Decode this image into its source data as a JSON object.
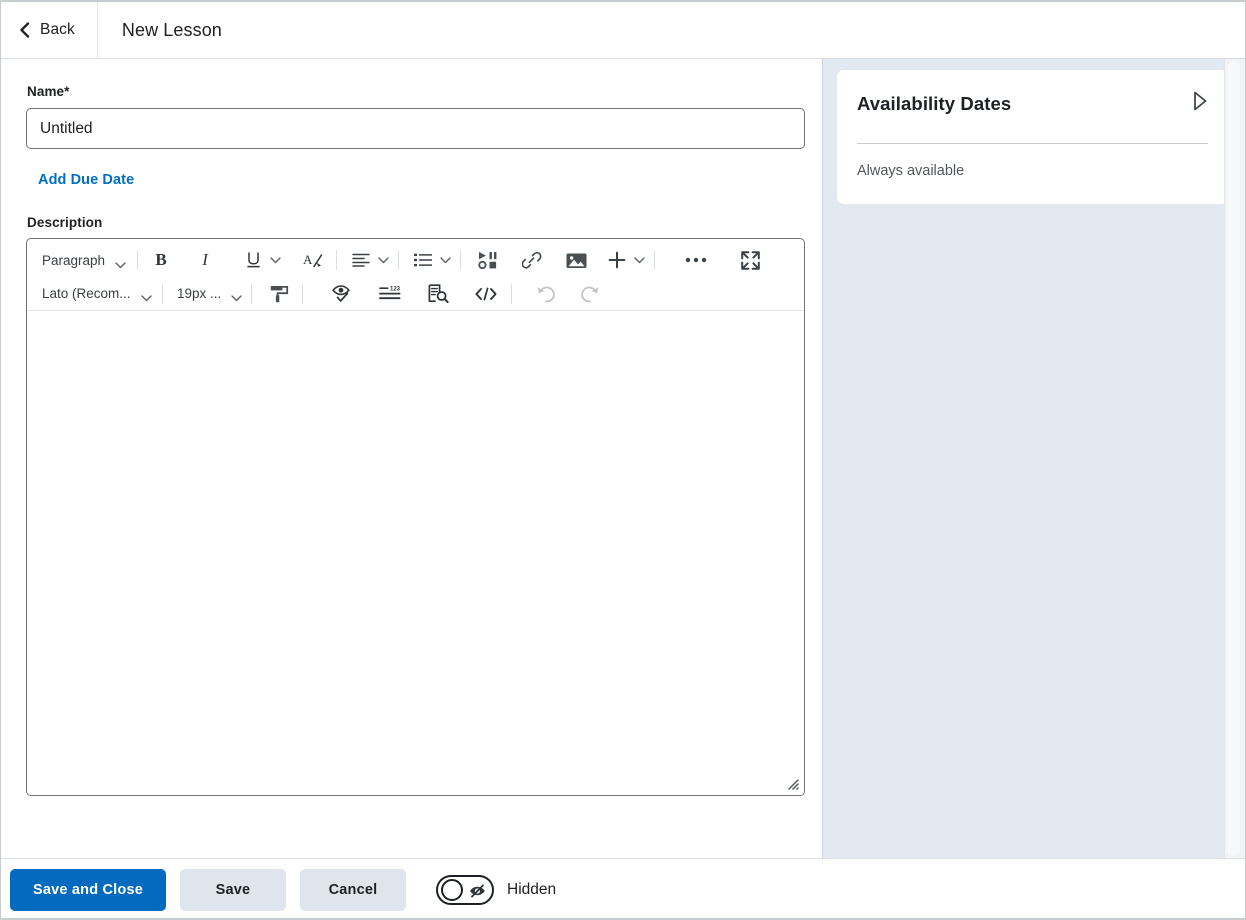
{
  "header": {
    "back_label": "Back",
    "title": "New Lesson",
    "back_icon": "chevron-left-icon"
  },
  "form": {
    "name_label": "Name",
    "name_required_mark": "*",
    "name_value": "Untitled",
    "name_placeholder": "Untitled",
    "add_due_date_label": "Add Due Date",
    "description_label": "Description"
  },
  "editor": {
    "toolbar_row1": [
      {
        "kind": "select",
        "name": "paragraph-format-select",
        "label": "Paragraph",
        "icon": "chevron-down-icon"
      },
      {
        "kind": "separator",
        "name": "toolbar-separator"
      },
      {
        "kind": "button",
        "name": "bold-button",
        "icon": "bold-icon",
        "label": "B"
      },
      {
        "kind": "button",
        "name": "italic-button",
        "icon": "italic-icon",
        "label": "I"
      },
      {
        "kind": "button",
        "name": "underline-button",
        "icon": "underline-icon",
        "label": "U"
      },
      {
        "kind": "caret",
        "name": "underline-options-caret",
        "icon": "chevron-down-icon"
      },
      {
        "kind": "button",
        "name": "clear-formatting-button",
        "icon": "clear-formatting-icon"
      },
      {
        "kind": "separator",
        "name": "toolbar-separator"
      },
      {
        "kind": "button",
        "name": "align-button",
        "icon": "align-left-icon"
      },
      {
        "kind": "caret",
        "name": "align-options-caret",
        "icon": "chevron-down-icon"
      },
      {
        "kind": "separator",
        "name": "toolbar-separator"
      },
      {
        "kind": "button",
        "name": "list-button",
        "icon": "bulleted-list-icon"
      },
      {
        "kind": "caret",
        "name": "list-options-caret",
        "icon": "chevron-down-icon"
      },
      {
        "kind": "separator",
        "name": "toolbar-separator"
      },
      {
        "kind": "button",
        "name": "insert-stuff-button",
        "icon": "insert-stuff-icon"
      },
      {
        "kind": "button",
        "name": "insert-link-button",
        "icon": "link-icon"
      },
      {
        "kind": "button",
        "name": "insert-image-button",
        "icon": "image-icon"
      },
      {
        "kind": "button",
        "name": "add-button",
        "icon": "plus-icon"
      },
      {
        "kind": "caret",
        "name": "add-options-caret",
        "icon": "chevron-down-icon"
      },
      {
        "kind": "separator",
        "name": "toolbar-separator"
      },
      {
        "kind": "button",
        "name": "more-options-button",
        "icon": "ellipsis-icon"
      },
      {
        "kind": "button",
        "name": "fullscreen-button",
        "icon": "expand-icon"
      }
    ],
    "toolbar_row2": [
      {
        "kind": "select",
        "name": "font-family-select",
        "label": "Lato (Recom...",
        "icon": "chevron-down-icon"
      },
      {
        "kind": "separator",
        "name": "toolbar-separator"
      },
      {
        "kind": "select",
        "name": "font-size-select",
        "label": "19px ...",
        "icon": "chevron-down-icon"
      },
      {
        "kind": "separator",
        "name": "toolbar-separator"
      },
      {
        "kind": "button",
        "name": "format-painter-button",
        "icon": "paint-roller-icon"
      },
      {
        "kind": "separator",
        "name": "toolbar-separator"
      },
      {
        "kind": "button",
        "name": "accessibility-checker-button",
        "icon": "eye-check-icon"
      },
      {
        "kind": "button",
        "name": "word-count-button",
        "icon": "word-count-icon"
      },
      {
        "kind": "button",
        "name": "preview-button",
        "icon": "document-search-icon"
      },
      {
        "kind": "button",
        "name": "html-source-button",
        "icon": "code-icon"
      },
      {
        "kind": "separator",
        "name": "toolbar-separator"
      },
      {
        "kind": "button-disabled",
        "name": "undo-button",
        "icon": "undo-icon"
      },
      {
        "kind": "button-disabled",
        "name": "redo-button",
        "icon": "redo-icon"
      }
    ],
    "content": "",
    "resize_grip_icon": "resize-grip-icon"
  },
  "side_panel": {
    "availability": {
      "title": "Availability Dates",
      "expand_icon": "triangle-right-icon",
      "status": "Always available"
    }
  },
  "footer": {
    "save_and_close_label": "Save and Close",
    "save_label": "Save",
    "cancel_label": "Cancel",
    "visibility_toggle_label": "Hidden",
    "visibility_toggle_state": "off",
    "visibility_icon": "eye-slash-icon"
  },
  "colors": {
    "accent": "#026bc0",
    "link": "#006fbf",
    "side_panel_bg": "#e3e9f0",
    "secondary_button": "#dfe5ed",
    "text": "#202122"
  }
}
